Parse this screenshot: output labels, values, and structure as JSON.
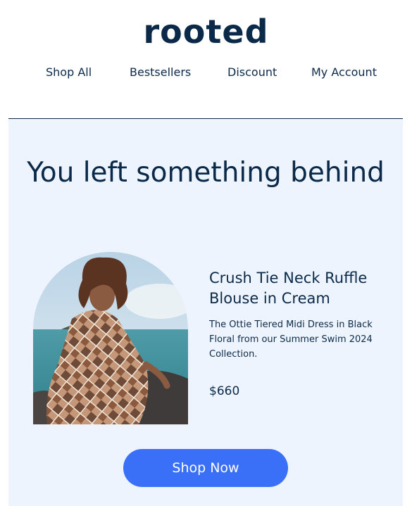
{
  "brand": {
    "logo_text": "rooted"
  },
  "nav": {
    "items": [
      {
        "label": "Shop All"
      },
      {
        "label": "Bestsellers"
      },
      {
        "label": "Discount"
      },
      {
        "label": "My Account"
      }
    ]
  },
  "main": {
    "headline": "You left something behind",
    "product": {
      "name": "Crush Tie Neck Ruffle Blouse in Cream",
      "description": "The Ottie Tiered Midi Dress in Black Floral from our Summer Swim 2024 Collection.",
      "price": "$660"
    },
    "cta_label": "Shop Now"
  },
  "colors": {
    "brand_navy": "#0b2a4a",
    "panel_background": "#eef4fd",
    "button_blue": "#3a6ff7"
  }
}
